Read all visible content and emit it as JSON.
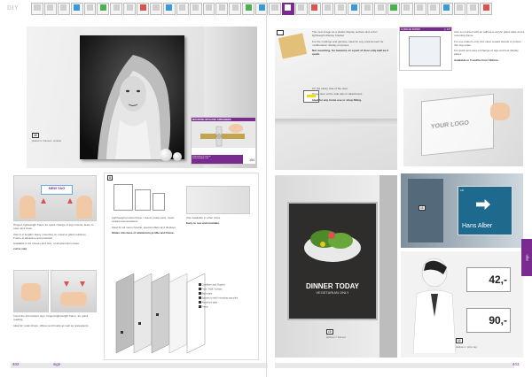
{
  "header": {
    "corner_logo": "DIY",
    "thumbs": 35,
    "thumb_labels": [
      "",
      "",
      "",
      "",
      "",
      "",
      "",
      "",
      "",
      "",
      "",
      "",
      "",
      "",
      "",
      "",
      "",
      "",
      "",
      "",
      "",
      "",
      "",
      "",
      "",
      "",
      "",
      "",
      "",
      "",
      "",
      "",
      "",
      "",
      ""
    ]
  },
  "left_page": {
    "main_photo": {
      "number": "18",
      "caption": "platinum / framed / vertical"
    },
    "mounting": {
      "title": "MOUNTING WITH DISC SPREADERS",
      "info_line1": "Information & vertical",
      "info_line2": "www.example.com",
      "page_ref": "154"
    },
    "step_photos": {
      "frame_label": "NEW TAG",
      "text1": "Hinged, lightweight frame for quick change of sign inserts. Easy to open and close.",
      "text2": "Also in 2 lengths. Easy mounting on metal or glass surfaces. Frame is attractive and practical.",
      "text3": "Available in 10 colours and size, of all aluminium base.",
      "text4": "cut to size",
      "text5": "Insert the information sign, hinged lightweight frame, for quick reading.",
      "text6": "Ideal for retail shops, offices and hotels as well as restaurants."
    },
    "diagram": {
      "number": "8",
      "text1": "Lightweight pocket frame / stand, poster-size, clear-coated and anodised.",
      "text2": "Ideal for all menu boards, special offers and displays.",
      "text3": "Slides into base of aluminium profile and frame.",
      "text4": "Also available in other sizes.",
      "text5": "Easy to use and maintain.",
      "legend": [
        "Conditions and Support",
        "Front / Wall / surface",
        "Back plate",
        "Spacers to wall / mounting sign plate",
        "Aluminium plate",
        "Frame"
      ]
    },
    "footer_page": "402",
    "footer_section": "sign"
  },
  "right_page": {
    "top_text": {
      "p1": "The new image as a plastic display surface and a thin lightweight display bracket.",
      "p2": "For the coatings and glosses, ideal for any environment for multilocation display purposes.",
      "p3": "Not mounting, for instance on a part of door-only wall as it quick.",
      "p4": "On the sticky side of the door.",
      "p5": "Hinge door at the side also in attachment.",
      "p6": "Ideal for any home use or shop fitting."
    },
    "signage_label": "GUIDE DE PAPIER",
    "signage_page": "p. 107",
    "product_logo": "YOUR LOGO",
    "right_text": {
      "p1": "Also a mounted with an adhesive acrylic glass plate and a mounting frame.",
      "p2": "For use indoors only, this clear coated stands or pocket thin sign plate.",
      "p3": "For quick and easy exchange of sign and text display plates.",
      "p4": "Available in 5 widths from 100mm."
    },
    "menu_poster": {
      "title": "DINNER TODAY",
      "subtitle": "VEGETARIAN ONLY",
      "number": "19",
      "caption": "platinum / framed"
    },
    "door_sign": {
      "number": "13",
      "text": "Hans Alber",
      "small": "Lift"
    },
    "price_tags": {
      "price1": "42,-",
      "price2": "90,-",
      "number": "14",
      "caption": "platinum / price tag"
    },
    "side_tab": "sign",
    "footer_page": "403"
  }
}
